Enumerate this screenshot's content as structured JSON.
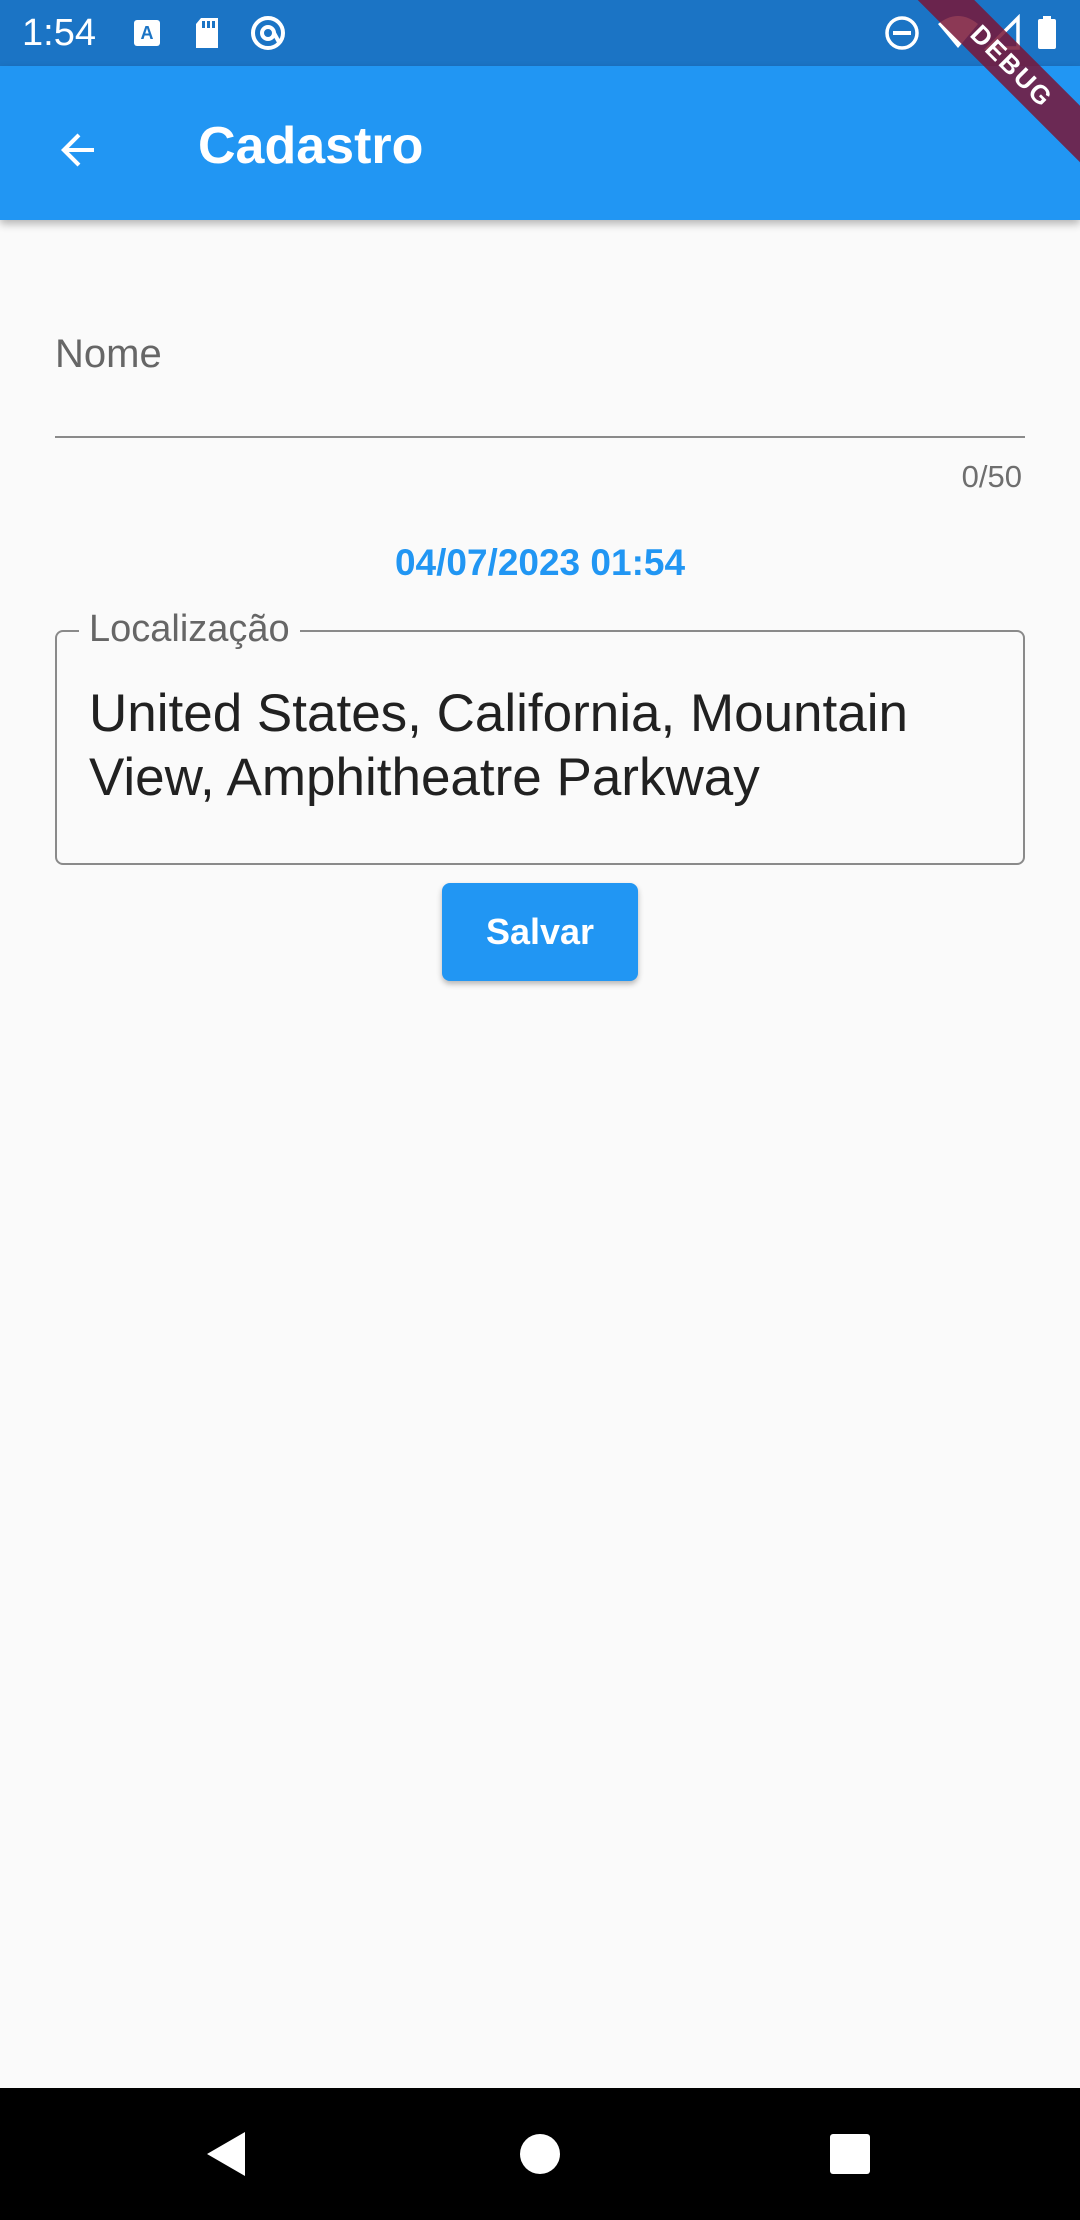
{
  "status_bar": {
    "time": "1:54",
    "left_icons": [
      "a-keyboard-icon",
      "sd-card-icon",
      "at-sign-icon"
    ],
    "right_icons": [
      "do-not-disturb-icon",
      "wifi-icon",
      "signal-icon",
      "battery-icon"
    ]
  },
  "app_bar": {
    "title": "Cadastro",
    "back_icon": "arrow-back-icon",
    "debug_banner": "DEBUG",
    "color": "#2196F3"
  },
  "form": {
    "name_field": {
      "label": "Nome",
      "value": "",
      "counter": "0/50"
    },
    "date_time": "04/07/2023 01:54",
    "location_field": {
      "label": "Localização",
      "value": "United States, California, Mountain View, Amphitheatre Parkway"
    },
    "save_label": "Salvar"
  },
  "nav_bar": {
    "icons": [
      "back-triangle-icon",
      "home-circle-icon",
      "recents-square-icon"
    ]
  }
}
